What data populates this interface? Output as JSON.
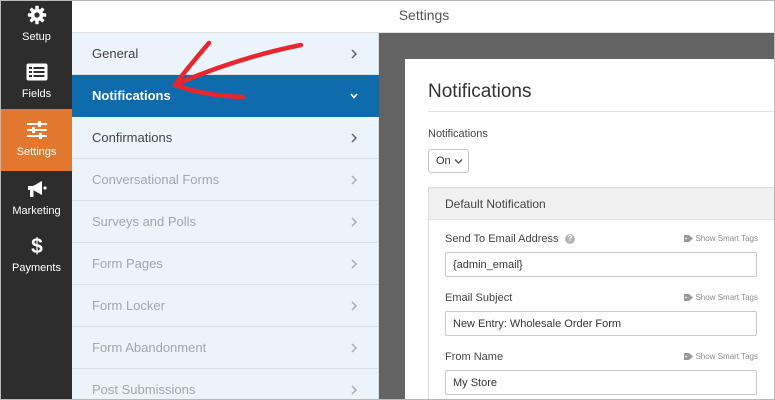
{
  "sidebar": {
    "items": [
      {
        "label": "Setup",
        "icon": "gear-icon"
      },
      {
        "label": "Fields",
        "icon": "list-icon"
      },
      {
        "label": "Settings",
        "icon": "sliders-icon",
        "active": true
      },
      {
        "label": "Marketing",
        "icon": "megaphone-icon"
      },
      {
        "label": "Payments",
        "icon": "dollar-icon"
      }
    ],
    "active_color": "#e27730"
  },
  "header": {
    "title": "Settings"
  },
  "settings_nav": {
    "items": [
      {
        "label": "General"
      },
      {
        "label": "Notifications",
        "active": true
      },
      {
        "label": "Confirmations"
      },
      {
        "label": "Conversational Forms",
        "dim": true
      },
      {
        "label": "Surveys and Polls",
        "dim": true
      },
      {
        "label": "Form Pages",
        "dim": true
      },
      {
        "label": "Form Locker",
        "dim": true
      },
      {
        "label": "Form Abandonment",
        "dim": true
      },
      {
        "label": "Post Submissions",
        "dim": true
      }
    ],
    "active_color": "#0e6cad"
  },
  "panel": {
    "title": "Notifications",
    "notifications_label": "Notifications",
    "notifications_value": "On",
    "default_notification": {
      "title": "Default Notification",
      "smart_tags_label": "Show Smart Tags",
      "send_to": {
        "label": "Send To Email Address",
        "value": "{admin_email}"
      },
      "subject": {
        "label": "Email Subject",
        "value": "New Entry: Wholesale Order Form"
      },
      "from_name": {
        "label": "From Name",
        "value": "My Store"
      }
    }
  },
  "annotation": {
    "arrow_color": "#e8262d"
  }
}
